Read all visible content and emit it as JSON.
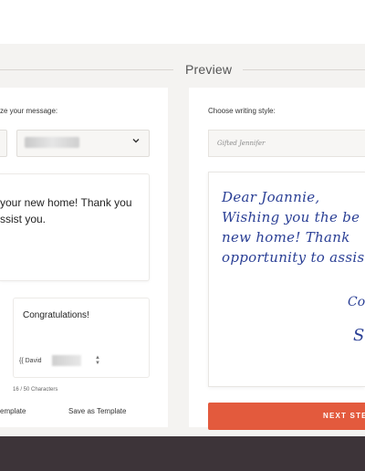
{
  "section": {
    "title": "Preview"
  },
  "left": {
    "customize_label": "ze your message:",
    "message_lines": [
      "your new home! Thank you",
      "ssist you."
    ],
    "closing": {
      "greeting": "Congratulations!",
      "signature_prefix": "{{ David"
    },
    "char_count": "16 / 50 Characters",
    "template_link": "emplate",
    "save_template_link": "Save as Template"
  },
  "right": {
    "writing_style_label": "Choose writing style:",
    "writing_style_value": "Gifted Jennifer",
    "handwriting": {
      "lines": [
        "Dear Joannie,",
        "Wishing you the be",
        "new home! Thank",
        "opportunity to assist"
      ],
      "closing_fragment": "Co",
      "signature_fragment": "S"
    },
    "next_button": "NEXT STE"
  },
  "colors": {
    "accent": "#e35a3d",
    "ink": "#2a3f95",
    "footer": "#3d3439"
  }
}
